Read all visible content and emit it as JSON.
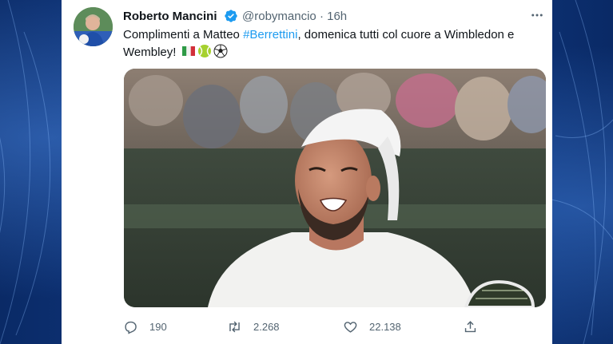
{
  "tweet": {
    "author_name": "Roberto Mancini",
    "handle": "@robymancio",
    "separator": "·",
    "time": "16h",
    "text_parts": {
      "before_hashtag": "Complimenti a Matteo ",
      "hashtag": "#Berrettini",
      "after_hashtag": ", domenica tutti col cuore a Wimbledon e Wembley!"
    },
    "emojis": [
      "italy-flag-icon",
      "tennis-ball-icon",
      "soccer-ball-icon"
    ]
  },
  "actions": {
    "replies": "190",
    "retweets": "2.268",
    "likes": "22.138"
  },
  "icons": {
    "verified": "verified-badge-icon",
    "more": "more-options-icon",
    "reply": "reply-icon",
    "retweet": "retweet-icon",
    "like": "heart-icon",
    "share": "share-icon"
  },
  "colors": {
    "accent": "#1d9bf0",
    "text": "#0f1419",
    "muted": "#536471",
    "background": "#0b2a63"
  }
}
